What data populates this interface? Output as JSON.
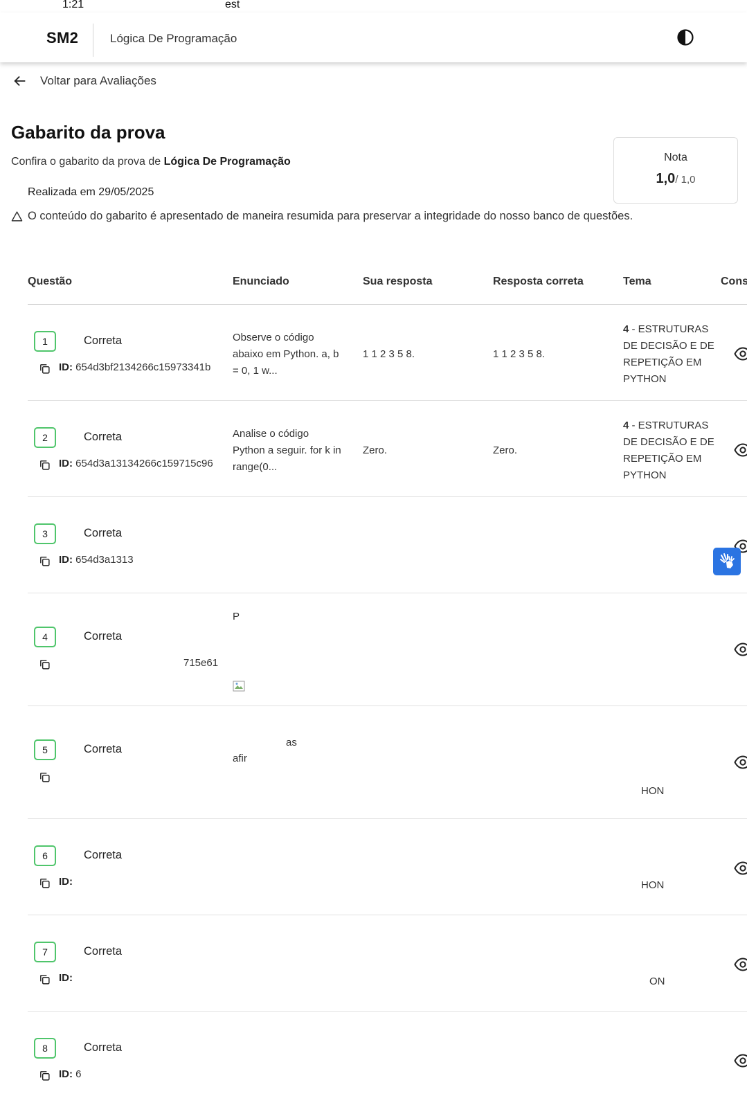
{
  "status_bar": {
    "time": "1:21",
    "carrier": "est"
  },
  "header": {
    "logo": "SM2",
    "course": "Lógica De Programação",
    "theme_icon": "contrast-icon"
  },
  "back": {
    "label": "Voltar para Avaliações"
  },
  "page": {
    "title": "Gabarito da prova",
    "subtitle_prefix": "Confira o gabarito da prova de ",
    "subtitle_course": "Lógica De Programação",
    "done_date": "Realizada em 29/05/2025",
    "notice": "O conteúdo do gabarito é apresentado de maneira resumida para preservar a integridade do nosso banco de questões."
  },
  "grade": {
    "label": "Nota",
    "value": "1,0",
    "max": "/ 1,0"
  },
  "table": {
    "headers": {
      "question": "Questão",
      "statement": "Enunciado",
      "your_answer": "Sua resposta",
      "correct_answer": "Resposta correta",
      "theme": "Tema",
      "consult": "Consu"
    },
    "id_label": "ID:",
    "rows": [
      {
        "num": "1",
        "status": "Correta",
        "id": "654d3bf2134266c15973341b",
        "statement": [
          "Observe o código",
          "abaixo em Python. a, b",
          "= 0, 1 w..."
        ],
        "your_answer": "1 1 2 3 5 8.",
        "correct_answer": "1 1 2 3 5 8.",
        "theme_num": "4",
        "theme": [
          "- ESTRUTURAS",
          "DE DECISÃO E DE",
          "REPETIÇÃO EM",
          "PYTHON"
        ]
      },
      {
        "num": "2",
        "status": "Correta",
        "id": "654d3a13134266c159715c96",
        "statement": [
          "Analise o código",
          "Python a seguir. for k in",
          "range(0..."
        ],
        "your_answer": "Zero.",
        "correct_answer": "Zero.",
        "theme_num": "4",
        "theme": [
          "- ESTRUTURAS",
          "DE DECISÃO E DE",
          "REPETIÇÃO EM",
          "PYTHON"
        ]
      },
      {
        "num": "3",
        "status": "Correta",
        "id": "654d3a1313"
      },
      {
        "num": "4",
        "status": "Correta",
        "id_fragment": "715e61",
        "statement_fragment": "P"
      },
      {
        "num": "5",
        "status": "Correta",
        "statement_fragment_1": "as",
        "statement_fragment_2": "afir",
        "theme_fragment": "HON"
      },
      {
        "num": "6",
        "status": "Correta",
        "theme_fragment": "HON"
      },
      {
        "num": "7",
        "status": "Correta",
        "theme_fragment": "ON"
      },
      {
        "num": "8",
        "status": "Correta",
        "id": "6"
      }
    ]
  },
  "icons": {
    "back": "arrow-left-icon",
    "copy": "copy-icon",
    "view": "eye-icon",
    "warning": "warning-triangle-icon",
    "libras": "sign-language-hands-icon"
  }
}
